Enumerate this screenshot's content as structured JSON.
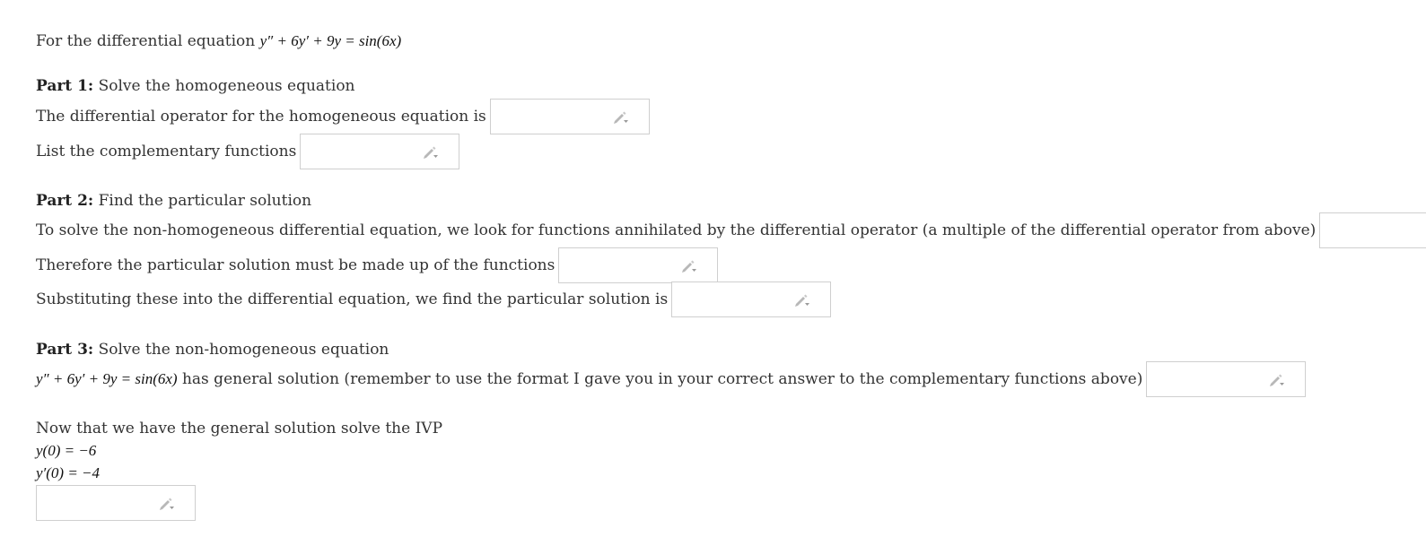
{
  "intro": {
    "text": "For the differential equation",
    "equation": "y″ + 6y′ + 9y = sin(6x)"
  },
  "part1": {
    "heading_bold": "Part 1:",
    "heading_text": "Solve the homogeneous equation",
    "operator_prompt": "The differential operator for the homogeneous equation is",
    "complementary_prompt": "List the complementary functions"
  },
  "part2": {
    "heading_bold": "Part 2:",
    "heading_text": "Find the particular solution",
    "annihilator_prompt": "To solve the non-homogeneous differential equation, we look for functions annihilated by the differential operator (a multiple of the differential operator from above)",
    "functions_prompt": "Therefore the particular solution must be made up of the functions",
    "particular_prompt": "Substituting these into the differential equation, we find the particular solution is"
  },
  "part3": {
    "heading_bold": "Part 3:",
    "heading_text": "Solve the non-homogeneous equation",
    "equation": "y″ + 6y′ + 9y = sin(6x)",
    "general_prompt": "has general solution (remember to use the format I gave you in your correct answer to the complementary functions above)"
  },
  "ivp": {
    "prompt": "Now that we have the general solution solve the IVP",
    "condition1": "y(0) = −6",
    "condition2": "y′(0) = −4"
  },
  "icons": {
    "answer_field_icon": "pencil-dropdown-icon"
  },
  "colors": {
    "text": "#333333",
    "input_border": "#cfcfcf",
    "icon": "#b0b0b0"
  }
}
